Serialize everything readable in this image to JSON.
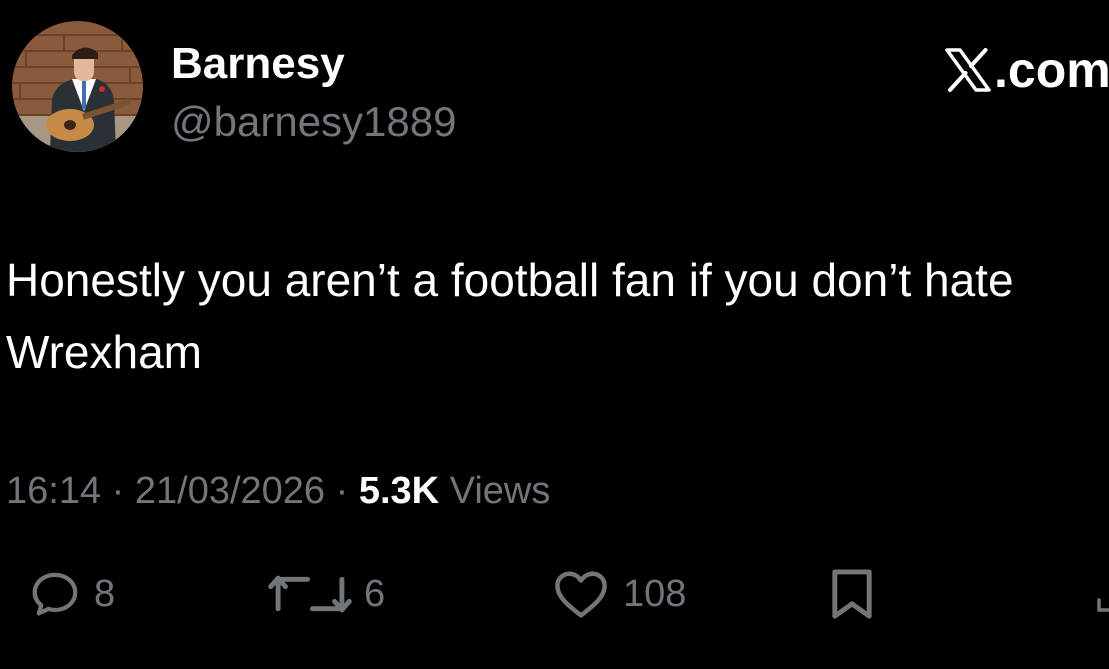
{
  "author": {
    "display_name": "Barnesy",
    "handle": "@barnesy1889",
    "avatar_icon": "guitarist-avatar"
  },
  "brand": {
    "domain": ".com",
    "icon": "x-logo-icon"
  },
  "tweet": {
    "text": "Honestly you aren’t a football fan if you don’t hate Wrexham"
  },
  "meta": {
    "time": "16:14",
    "separator": "·",
    "date": "21/03/2026",
    "views_count": "5.3K",
    "views_label": "Views"
  },
  "actions": {
    "replies": "8",
    "reposts": "6",
    "likes": "108"
  },
  "colors": {
    "background": "#000000",
    "primary_text": "#ffffff",
    "secondary_text": "#71767b"
  }
}
